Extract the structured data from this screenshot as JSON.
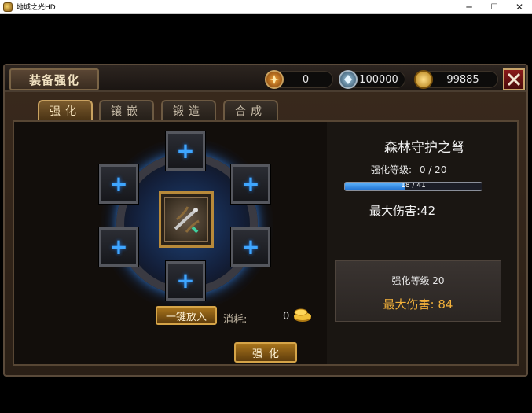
{
  "window": {
    "title": "地城之光HD",
    "minimize_glyph": "─",
    "maximize_glyph": "☐",
    "close_glyph": "✕"
  },
  "header": {
    "title": "装备强化",
    "currencies": [
      {
        "icon": "fire-emblem-icon",
        "value": "0"
      },
      {
        "icon": "crystal-emblem-icon",
        "value": "100000"
      },
      {
        "icon": "gold-coin-icon",
        "value": "99885"
      }
    ]
  },
  "tabs": [
    {
      "label": "强化",
      "active": true
    },
    {
      "label": "镶嵌",
      "active": false
    },
    {
      "label": "锻造",
      "active": false
    },
    {
      "label": "合成",
      "active": false
    }
  ],
  "socket_slots": [
    {
      "position": "top",
      "icon": "plus-icon"
    },
    {
      "position": "upper-left",
      "icon": "plus-icon"
    },
    {
      "position": "upper-right",
      "icon": "plus-icon"
    },
    {
      "position": "lower-left",
      "icon": "plus-icon"
    },
    {
      "position": "lower-right",
      "icon": "plus-icon"
    },
    {
      "position": "bottom",
      "icon": "plus-icon"
    }
  ],
  "center_item": {
    "icon": "crossbow-icon"
  },
  "actions": {
    "auto_fill_label": "一键放入",
    "cost_label": "消耗:",
    "cost_value": "0",
    "enhance_label": "强化"
  },
  "item": {
    "name": "森林守护之弩",
    "level_label": "强化等级:",
    "level_value": "0  / 20",
    "progress_text": "18 / 41",
    "progress_fraction": 0.44,
    "damage_text": "最大伤害:42"
  },
  "next": {
    "level_text": "强化等级 20",
    "damage_text": "最大伤害: 84"
  },
  "colors": {
    "accent_blue": "#3fa6ff",
    "gold": "#f3b13a",
    "close_red": "#8a1a1a"
  }
}
